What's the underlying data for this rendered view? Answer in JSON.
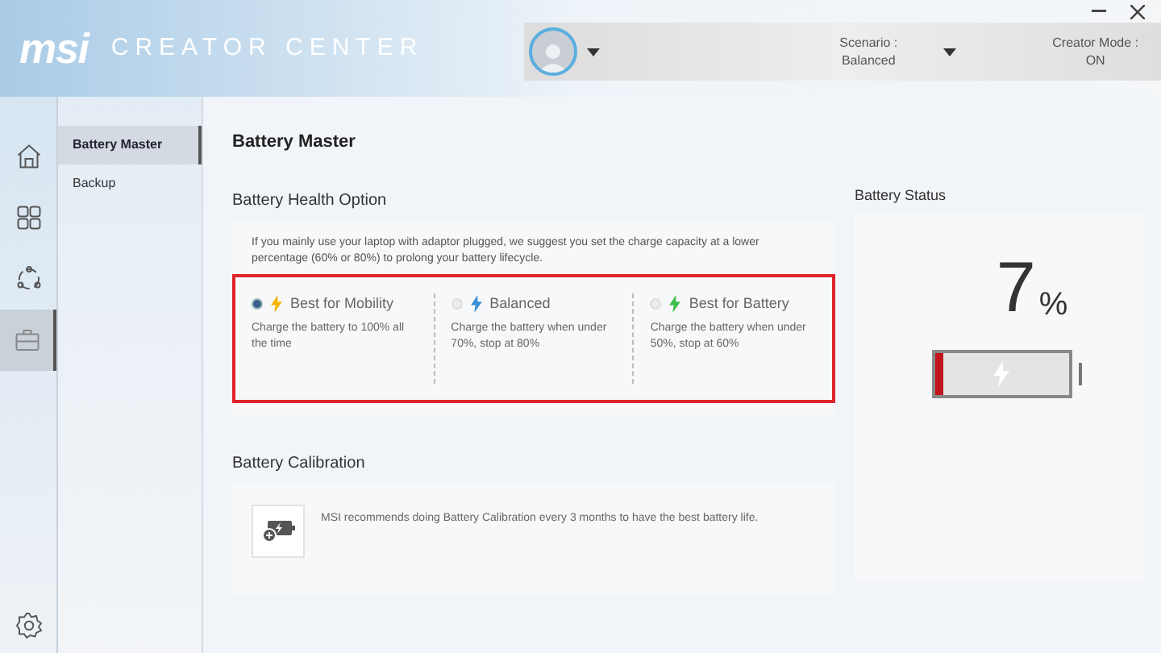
{
  "header": {
    "logo": "msi",
    "app_title": "CREATOR CENTER",
    "scenario": {
      "label": "Scenario :",
      "value": "Balanced"
    },
    "creator_mode": {
      "label": "Creator Mode :",
      "value": "ON"
    }
  },
  "rail": [
    {
      "kind": "home",
      "selected": false
    },
    {
      "kind": "grid",
      "selected": false
    },
    {
      "kind": "nodes",
      "selected": false
    },
    {
      "kind": "toolbox",
      "selected": true
    }
  ],
  "sidebar": {
    "items": [
      {
        "label": "Battery Master",
        "selected": true
      },
      {
        "label": "Backup",
        "selected": false
      }
    ]
  },
  "page_title": "Battery Master",
  "health": {
    "title": "Battery Health Option",
    "description": "If you mainly use your laptop with adaptor plugged, we suggest you set the charge capacity at a lower percentage (60% or 80%) to prolong your battery lifecycle.",
    "options": [
      {
        "label": "Best for Mobility",
        "description": "Charge the battery to 100% all the time",
        "selected": true,
        "color": "#f5b400"
      },
      {
        "label": "Balanced",
        "description": "Charge the battery when under 70%, stop at 80%",
        "selected": false,
        "color": "#3b8fd9"
      },
      {
        "label": "Best for Battery",
        "description": "Charge the battery when under 50%, stop at 60%",
        "selected": false,
        "color": "#3cbf4a"
      }
    ]
  },
  "calibration": {
    "title": "Battery Calibration",
    "description": "MSI recommends doing Battery Calibration every 3 months to have the best battery life."
  },
  "status": {
    "title": "Battery Status",
    "value": "7",
    "unit": "%",
    "level": 0.07
  }
}
